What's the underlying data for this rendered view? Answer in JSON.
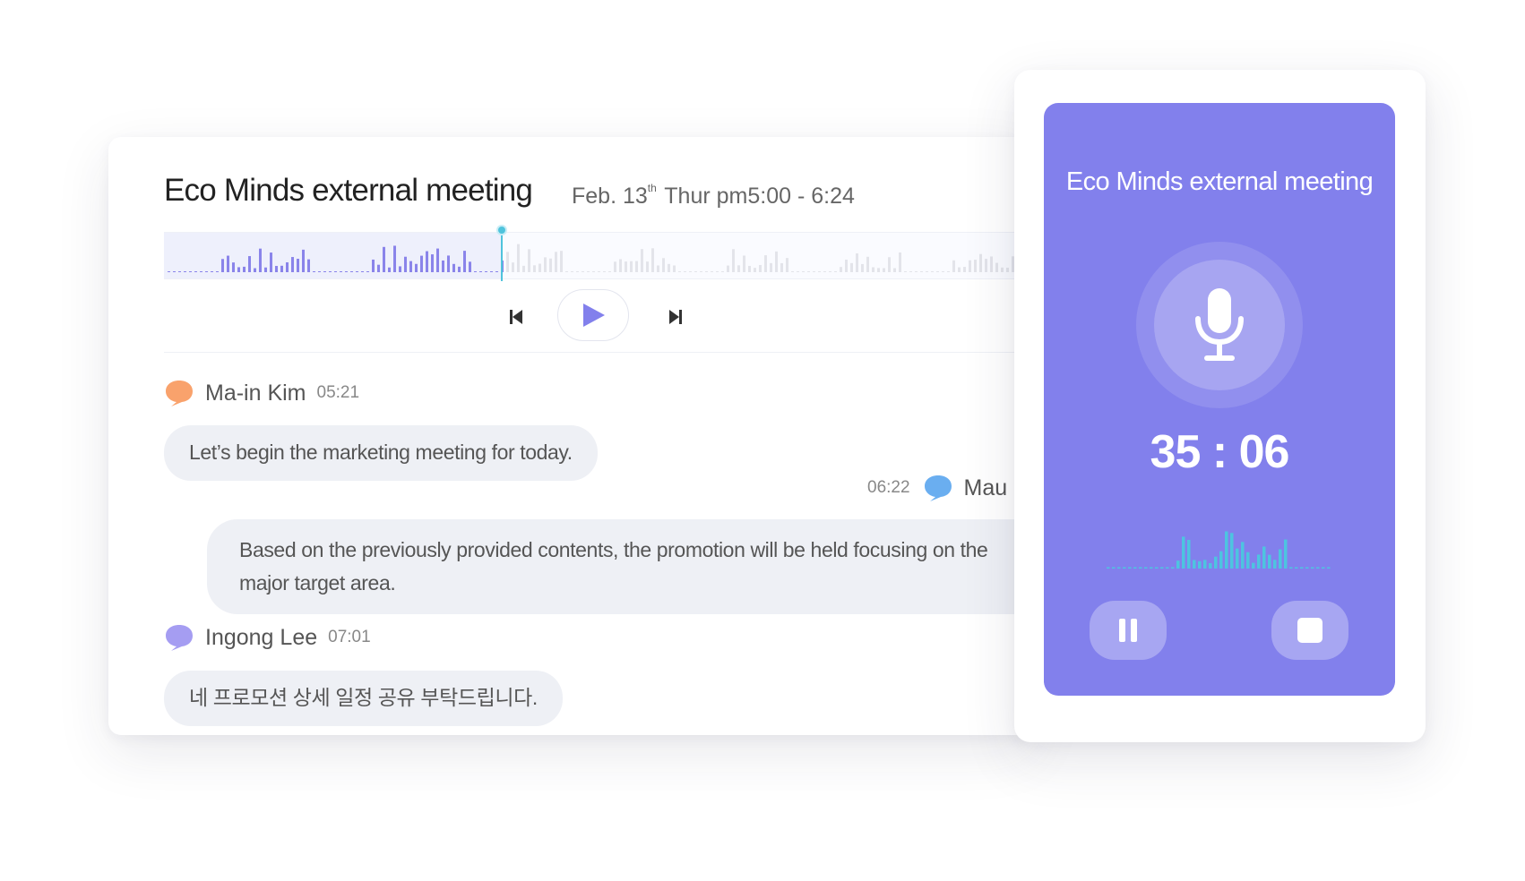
{
  "meeting": {
    "title": "Eco Minds external meeting",
    "date_prefix": "Feb. 13",
    "date_sup": "th",
    "date_suffix": " Thur pm5:00 - 6:24"
  },
  "player": {
    "progress": 0.385
  },
  "messages": [
    {
      "speaker": "Ma-in Kim",
      "time": "05:21",
      "text": "Let’s begin the marketing meeting for today.",
      "icon_color": "#f9a26c"
    },
    {
      "speaker": "Mau",
      "time": "06:22",
      "text": "Based on the previously provided contents, the promotion will be held focusing on the major target area.",
      "icon_color": "#6aaef0"
    },
    {
      "speaker": "Ingong Lee",
      "time": "07:01",
      "text": "네 프로모션 상세 일정 공유 부탁드립니다.",
      "icon_color": "#a59df2"
    }
  ],
  "recorder": {
    "title": "Eco Minds external meeting",
    "timer": "35 : 06"
  },
  "colors": {
    "accent": "#8280ec",
    "played_wave": "#8a84ea",
    "unplayed_wave": "#e3e4ea",
    "rec_wave": "#4dc4e0"
  },
  "icons": [
    "speech-bubble-icon",
    "skip-back-icon",
    "play-icon",
    "skip-forward-icon",
    "microphone-icon",
    "pause-icon",
    "stop-icon"
  ]
}
